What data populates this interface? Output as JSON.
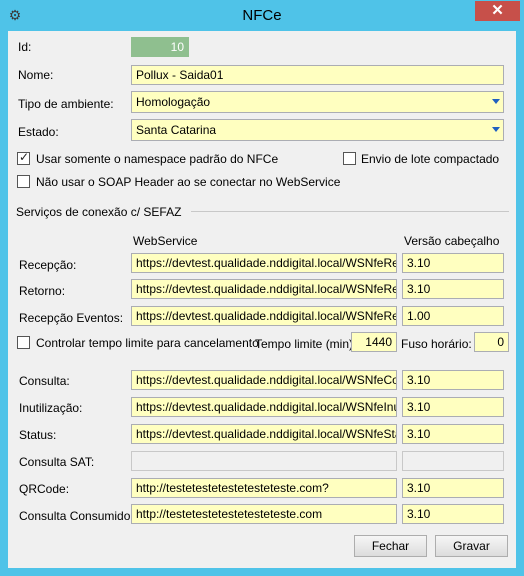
{
  "window": {
    "title": "NFCe",
    "close_glyph": "✕",
    "icon": "app-icon"
  },
  "fields": {
    "id": {
      "label": "Id:",
      "value": "10"
    },
    "nome": {
      "label": "Nome:",
      "value": "Pollux - Saida01"
    },
    "tipo_ambiente": {
      "label": "Tipo de ambiente:",
      "value": "Homologação"
    },
    "estado": {
      "label": "Estado:",
      "value": "Santa Catarina"
    }
  },
  "options": {
    "namespace": {
      "label": "Usar somente o namespace padrão do NFCe",
      "checked": true
    },
    "lote": {
      "label": "Envio de lote compactado",
      "checked": false
    },
    "soap": {
      "label": "Não usar o SOAP Header ao se conectar no WebService",
      "checked": false
    }
  },
  "services": {
    "group_label": "Serviços de conexão c/ SEFAZ",
    "col_ws": "WebService",
    "col_ver": "Versão cabeçalho",
    "recepcao": {
      "label": "Recepção:",
      "url": "https://devtest.qualidade.nddigital.local/WSNfeRec",
      "ver": "3.10"
    },
    "retorno": {
      "label": "Retorno:",
      "url": "https://devtest.qualidade.nddigital.local/WSNfeRet",
      "ver": "3.10"
    },
    "recepcao_eventos": {
      "label": "Recepção Eventos:",
      "url": "https://devtest.qualidade.nddigital.local/WSNfeRec",
      "ver": "1.00"
    },
    "controle": {
      "label": "Controlar tempo limite para cancelamento",
      "checked": false
    },
    "tempo_limite": {
      "label": "Tempo limite (min):",
      "value": "1440"
    },
    "fuso": {
      "label": "Fuso horário:",
      "value": "0"
    },
    "consulta": {
      "label": "Consulta:",
      "url": "https://devtest.qualidade.nddigital.local/WSNfeCon",
      "ver": "3.10"
    },
    "inutilizacao": {
      "label": "Inutilização:",
      "url": "https://devtest.qualidade.nddigital.local/WSNfeInuti",
      "ver": "3.10"
    },
    "status": {
      "label": "Status:",
      "url": "https://devtest.qualidade.nddigital.local/WSNfeStat",
      "ver": "3.10"
    },
    "consulta_sat": {
      "label": "Consulta SAT:",
      "url": "",
      "ver": ""
    },
    "qrcode": {
      "label": "QRCode:",
      "url": "http://testetestetestetesteteste.com?",
      "ver": "3.10"
    },
    "consulta_consumidor": {
      "label": "Consulta Consumidor:",
      "url": "http://testetestetestetesteteste.com",
      "ver": "3.10"
    }
  },
  "buttons": {
    "fechar": "Fechar",
    "gravar": "Gravar"
  }
}
